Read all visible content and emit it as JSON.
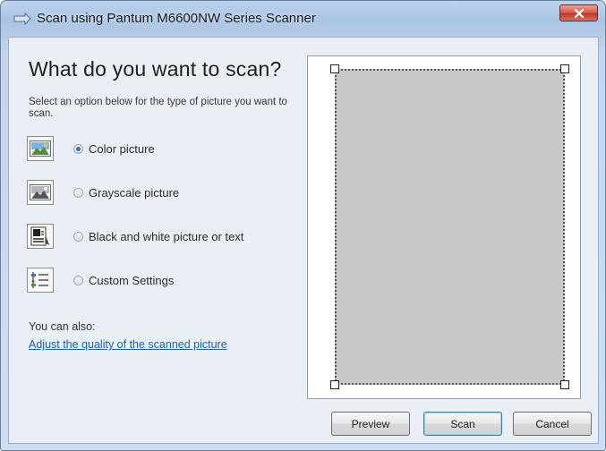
{
  "window": {
    "title": "Scan using Pantum M6600NW Series Scanner"
  },
  "main": {
    "heading": "What do you want to scan?",
    "subtext": "Select an option below for the type of picture you want to scan.",
    "options": [
      {
        "label": "Color picture",
        "checked": true,
        "icon": "color-picture-icon"
      },
      {
        "label": "Grayscale picture",
        "checked": false,
        "icon": "grayscale-picture-icon"
      },
      {
        "label": "Black and white picture or text",
        "checked": false,
        "icon": "black-white-text-icon"
      },
      {
        "label": "Custom Settings",
        "checked": false,
        "icon": "custom-settings-icon"
      }
    ],
    "also_label": "You can also:",
    "link_text": "Adjust the quality of the scanned picture"
  },
  "buttons": {
    "preview": "Preview",
    "scan": "Scan",
    "cancel": "Cancel"
  },
  "colors": {
    "link": "#1f5fa8",
    "scan_area": "#c8c8c8",
    "close_button": "#c0392b"
  }
}
